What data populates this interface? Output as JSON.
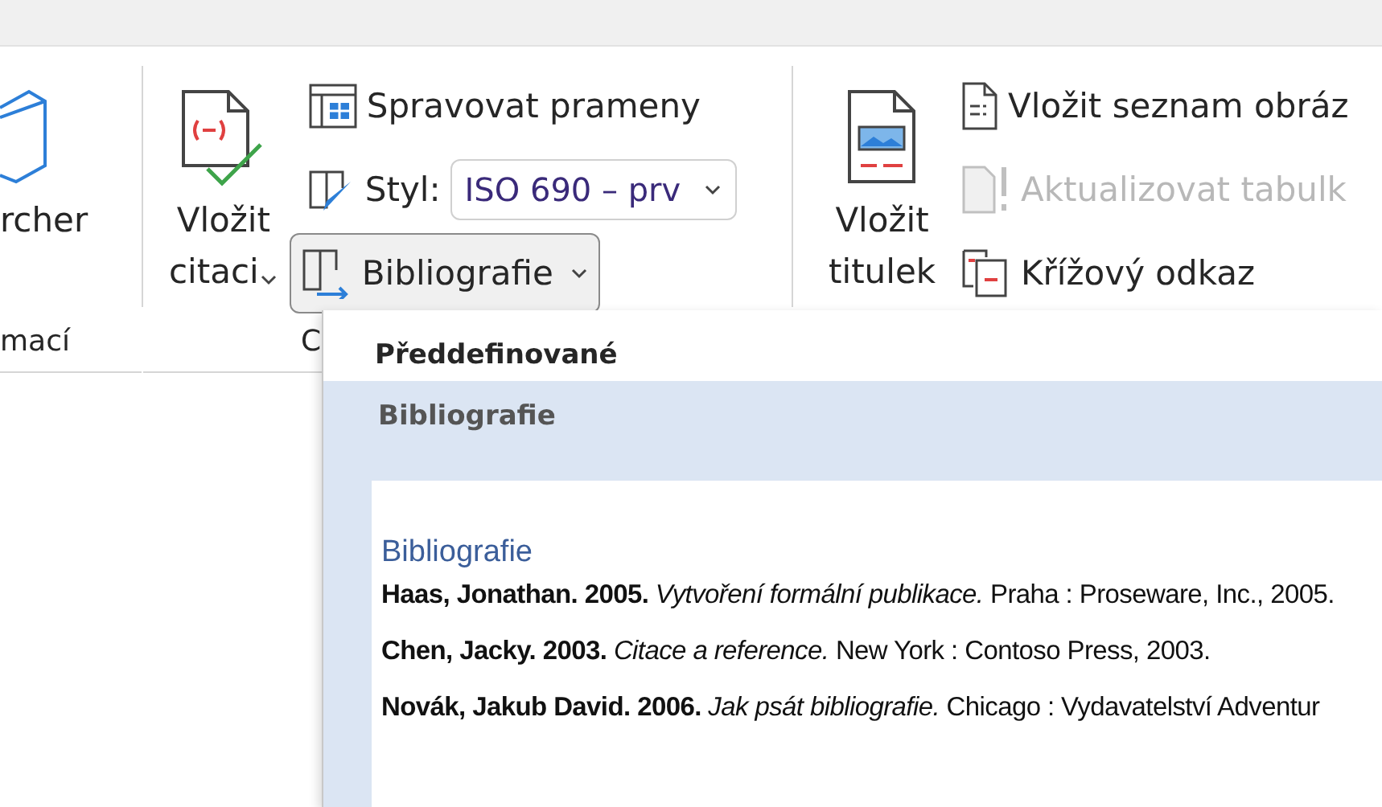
{
  "ribbon": {
    "researcher_group": {
      "button_label": "rcher",
      "group_label": "mací"
    },
    "citations_group": {
      "insert_citation": {
        "label_lines": [
          "Vložit",
          "citaci"
        ]
      },
      "manage_sources": "Spravovat prameny",
      "style_label": "Styl:",
      "style_value": "ISO 690 – prv",
      "bibliography": {
        "label": "Bibliografie",
        "pressed": true
      },
      "group_label": "C"
    },
    "captions_group": {
      "insert_caption": {
        "label_lines": [
          "Vložit",
          "titulek"
        ]
      },
      "items": [
        {
          "kind": "figures",
          "label": "Vložit seznam obráz",
          "disabled": false
        },
        {
          "kind": "update",
          "label": "Aktualizovat tabulk",
          "disabled": true
        },
        {
          "kind": "crossref",
          "label": "Křížový odkaz",
          "disabled": false
        }
      ]
    }
  },
  "dropdown": {
    "header": "Předdefinované",
    "items": [
      {
        "label": "Bibliografie",
        "selected": true,
        "preview": {
          "heading": "Bibliografie",
          "entries": [
            "**Haas, Jonathan. 2005.** *Vytvoření formální publikace.* Praha : Proseware, Inc., 2005.",
            "**Chen, Jacky. 2003.** *Citace a reference.* New York : Contoso Press, 2003.",
            "**Novák, Jakub David. 2006.** *Jak psát bibliografie.* Chicago : Vydavatelství Adventur"
          ]
        }
      }
    ]
  }
}
